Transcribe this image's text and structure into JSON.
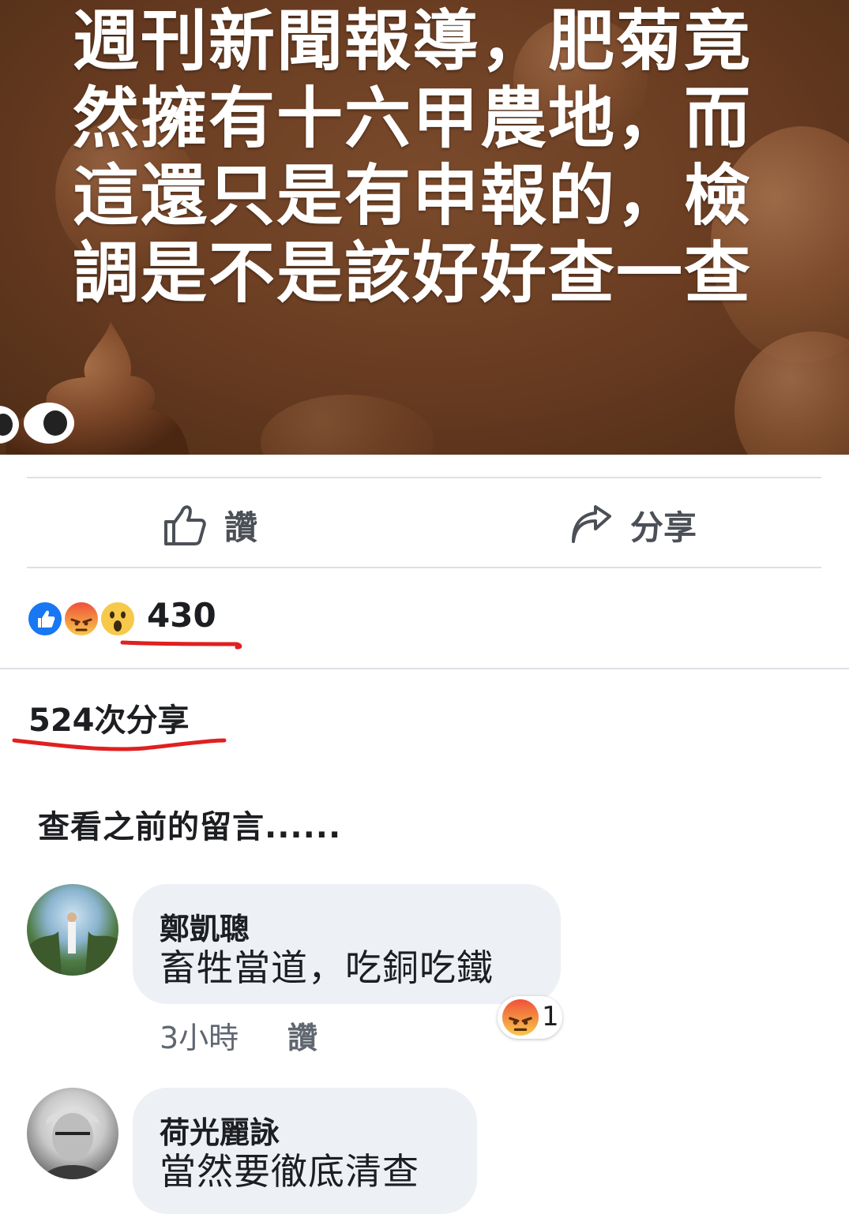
{
  "post": {
    "headline_lines": [
      "週刊新聞報導，肥菊竟",
      "然擁有十六甲農地，而",
      "這還只是有申報的，檢",
      "調是不是該好好查一查"
    ]
  },
  "actions": {
    "like_label": "讚",
    "share_label": "分享"
  },
  "reactions": {
    "count": "430",
    "types": [
      "like-icon",
      "angry-icon",
      "wow-icon"
    ]
  },
  "shares": {
    "label": "524次分享"
  },
  "comments": {
    "view_previous": "查看之前的留言......",
    "items": [
      {
        "name": "鄭凱聰",
        "text": "畜牲當道，吃銅吃鐵",
        "time": "3小時",
        "like_label": "讚",
        "reaction_count": "1",
        "reaction_icon": "angry-icon"
      },
      {
        "name": "荷光麗詠",
        "text": "當然要徹底清查"
      }
    ]
  },
  "colors": {
    "like_blue": "#1877f2",
    "annotation_red": "#e0201f",
    "bubble_gray": "#edf0f4",
    "post_brown": "#6a3d22"
  }
}
